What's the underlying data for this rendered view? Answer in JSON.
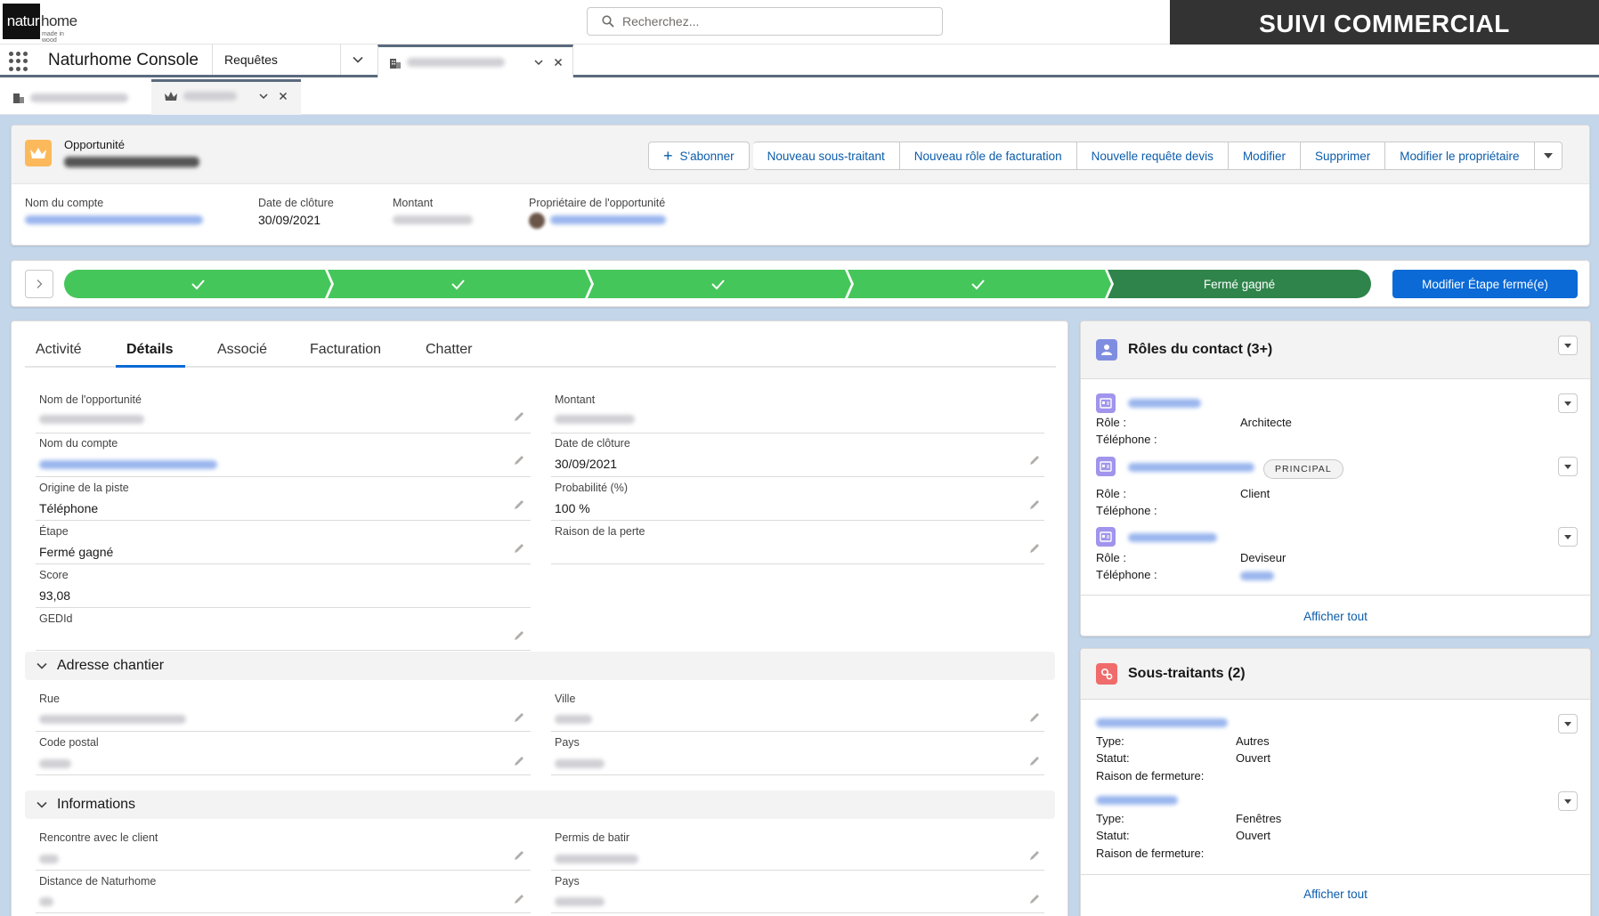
{
  "logo": {
    "part1": "natur",
    "part2": "home",
    "tagline": "made in wood"
  },
  "search": {
    "placeholder": "Recherchez..."
  },
  "banner": "SUIVI COMMERCIAL",
  "nav": {
    "app_name": "Naturhome Console",
    "tab_requetes": "Requêtes"
  },
  "header": {
    "object_type": "Opportunité",
    "buttons": {
      "subscribe": "S'abonner",
      "new_subcontractor": "Nouveau sous-traitant",
      "new_billing_role": "Nouveau rôle de facturation",
      "new_quote_request": "Nouvelle requête devis",
      "edit": "Modifier",
      "delete": "Supprimer",
      "change_owner": "Modifier le propriétaire"
    },
    "fields": {
      "account_label": "Nom du compte",
      "close_date_label": "Date de clôture",
      "close_date_value": "30/09/2021",
      "amount_label": "Montant",
      "owner_label": "Propriétaire de l'opportunité"
    }
  },
  "path": {
    "final_stage": "Fermé gagné",
    "button": "Modifier Étape fermé(e)"
  },
  "tabs": [
    "Activité",
    "Détails",
    "Associé",
    "Facturation",
    "Chatter"
  ],
  "details": {
    "left": [
      {
        "label": "Nom de l'opportunité",
        "value": ""
      },
      {
        "label": "Nom du compte",
        "value": ""
      },
      {
        "label": "Origine de la piste",
        "value": "Téléphone"
      },
      {
        "label": "Étape",
        "value": "Fermé gagné"
      },
      {
        "label": "Score",
        "value": "93,08"
      },
      {
        "label": "GEDId",
        "value": ""
      }
    ],
    "right": [
      {
        "label": "Montant",
        "value": ""
      },
      {
        "label": "Date de clôture",
        "value": "30/09/2021"
      },
      {
        "label": "Probabilité (%)",
        "value": "100 %"
      },
      {
        "label": "Raison de la perte",
        "value": ""
      }
    ]
  },
  "section_address": {
    "title": "Adresse chantier",
    "fields": [
      {
        "label": "Rue"
      },
      {
        "label": "Ville"
      },
      {
        "label": "Code postal"
      },
      {
        "label": "Pays"
      }
    ]
  },
  "section_info": {
    "title": "Informations",
    "fields": [
      {
        "label": "Rencontre avec le client"
      },
      {
        "label": "Permis de batir"
      },
      {
        "label": "Distance de Naturhome"
      },
      {
        "label": "Pays"
      }
    ]
  },
  "contact_roles": {
    "title": "Rôles du contact (3+)",
    "role_label": "Rôle :",
    "phone_label": "Téléphone :",
    "items": [
      {
        "role": "Architecte",
        "badge": ""
      },
      {
        "role": "Client",
        "badge": "PRINCIPAL"
      },
      {
        "role": "Deviseur",
        "badge": ""
      }
    ],
    "view_all": "Afficher tout"
  },
  "subcontractors": {
    "title": "Sous-traitants (2)",
    "type_label": "Type:",
    "status_label": "Statut:",
    "closing_reason_label": "Raison de fermeture:",
    "items": [
      {
        "type": "Autres",
        "status": "Ouvert"
      },
      {
        "type": "Fenêtres",
        "status": "Ouvert"
      }
    ],
    "view_all": "Afficher tout"
  },
  "colors": {
    "path_complete": "#45c65a",
    "path_current": "#2e844a",
    "brand": "#0b6ad6",
    "link": "#0b5cab"
  }
}
